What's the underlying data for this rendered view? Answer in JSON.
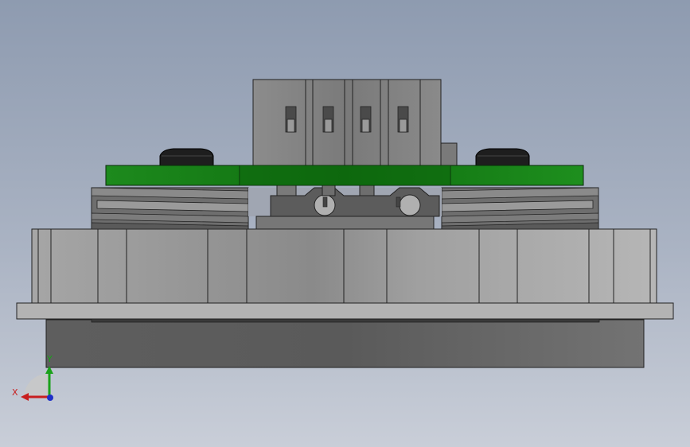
{
  "triad": {
    "y_label": "Y",
    "x_label": "X",
    "y_color": "#1aa11a",
    "x_color": "#c81e1e",
    "z_color": "#1e2fc8"
  },
  "colors": {
    "pcb_green": "#1a8a1a",
    "body_light": "#b4b4b4",
    "body_mid": "#8c8c8c",
    "base_dark": "#666666",
    "knob_black": "#1e1e1e"
  }
}
